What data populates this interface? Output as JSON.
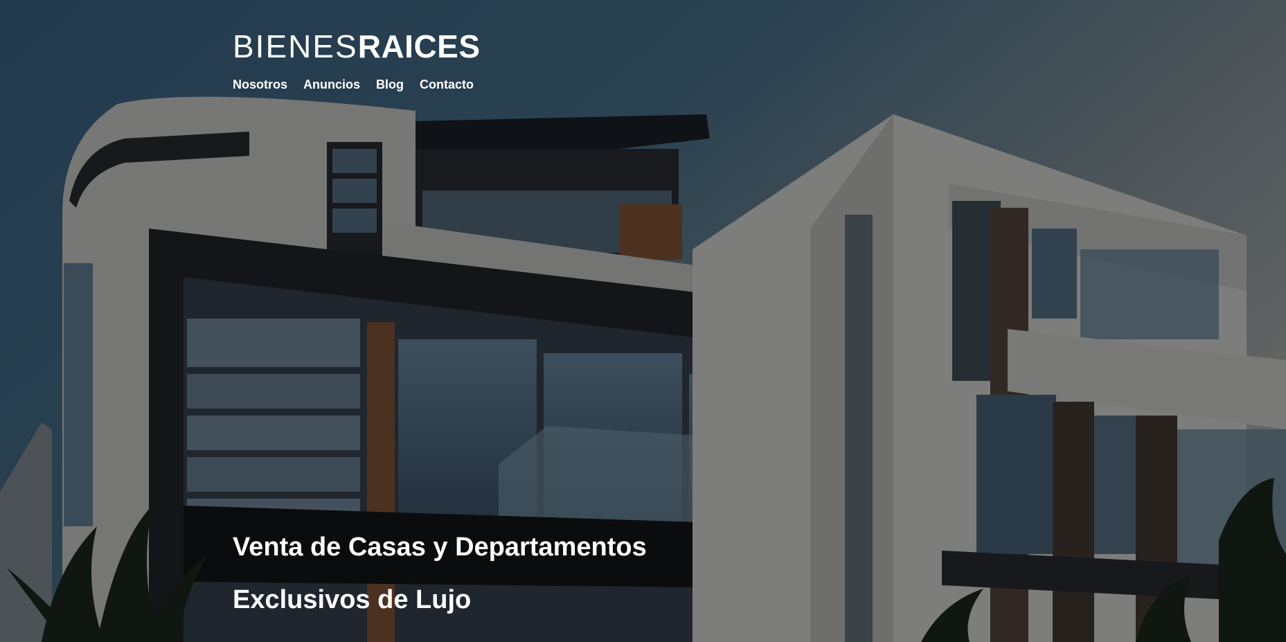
{
  "header": {
    "logo_light": "BIENES",
    "logo_bold": "RAICES"
  },
  "nav": {
    "items": [
      {
        "label": "Nosotros"
      },
      {
        "label": "Anuncios"
      },
      {
        "label": "Blog"
      },
      {
        "label": "Contacto"
      }
    ]
  },
  "hero": {
    "headline_line1": "Venta de Casas y Departamentos",
    "headline_line2": "Exclusivos de Lujo"
  },
  "colors": {
    "text": "#ffffff",
    "overlay": "rgba(0,0,0,0.45)",
    "sky": "#3a5a7a"
  }
}
